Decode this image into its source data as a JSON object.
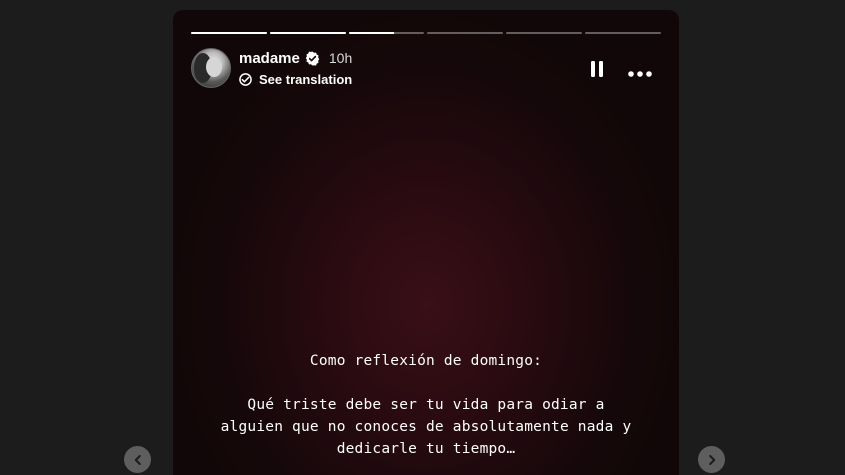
{
  "story": {
    "progress_segments": [
      1,
      1,
      0.6,
      0,
      0,
      0
    ],
    "header": {
      "username": "madame",
      "verified_icon": "verified-badge-icon",
      "time_ago": "10h",
      "see_translation": "See translation"
    },
    "controls": {
      "pause_icon": "pause-icon",
      "more_icon": "more-options-icon"
    },
    "text": {
      "line1": "Como reflexión de domingo:",
      "line2": "Qué triste debe ser tu vida para odiar a",
      "line3": "alguien que no conoces de absolutamente nada y",
      "line4": "dedicarle tu tiempo…"
    }
  },
  "navigation": {
    "prev_icon": "chevron-left-icon",
    "next_icon": "chevron-right-icon"
  },
  "colors": {
    "page_background": "#1c1c1c",
    "story_background": "#260a10",
    "nav_button": "#5e5e5e"
  }
}
